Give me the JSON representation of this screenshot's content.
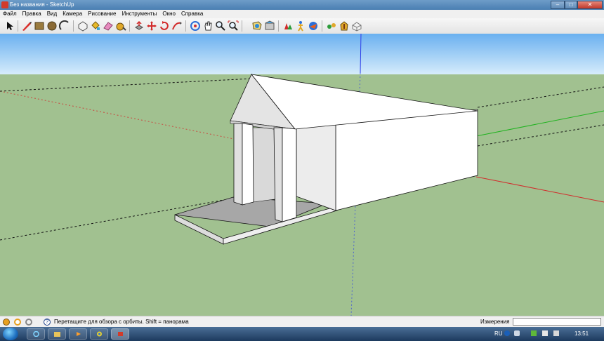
{
  "window": {
    "title": "Без названия - SketchUp"
  },
  "menu": [
    "Файл",
    "Правка",
    "Вид",
    "Камера",
    "Рисование",
    "Инструменты",
    "Окно",
    "Справка"
  ],
  "toolbar": {
    "icons": [
      "select-arrow-icon",
      "pencil-line-icon",
      "rectangle-icon",
      "circle-icon",
      "arc-icon",
      "eraser-icon",
      "paint-bucket-icon",
      "move-icon",
      "push-pull-icon",
      "rotate-icon",
      "follow-me-icon",
      "offset-icon",
      "orbit-icon",
      "pan-icon",
      "zoom-icon",
      "zoom-extents-icon",
      "tape-measure-icon",
      "protractor-icon",
      "dimension-icon",
      "walk-icon",
      "position-camera-icon",
      "look-around-icon",
      "google-earth-icon",
      "warehouse-icon",
      "components-icon",
      "upload-icon"
    ]
  },
  "status": {
    "hint": "Перетащите для обзора с орбиты.  Shift = панорама",
    "measurements_label": "Измерения",
    "measurements_value": ""
  },
  "taskbar": {
    "language": "RU",
    "clock": "13:51"
  },
  "colors": {
    "sky_top": "#6ab0f0",
    "sky_bottom": "#d6ecfb",
    "ground": "#a1c190",
    "axis_red": "#d22b2b",
    "axis_green": "#1fb31f",
    "axis_blue": "#2c3ee8"
  }
}
